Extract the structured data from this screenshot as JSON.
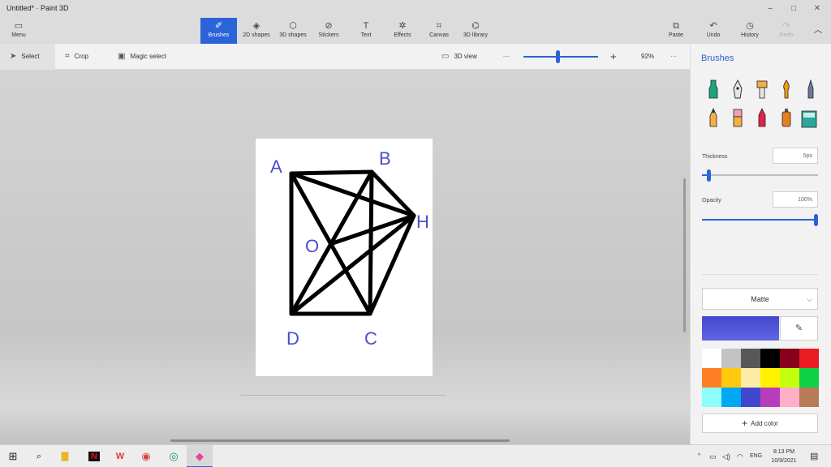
{
  "window": {
    "title": "Untitled* · Paint 3D",
    "controls": [
      "–",
      "□",
      "✕"
    ]
  },
  "ribbon": {
    "menu_label": "Menu",
    "tabs": [
      {
        "label": "Brushes",
        "icon": "brush-icon",
        "glyph": "✐"
      },
      {
        "label": "2D shapes",
        "icon": "2d-shapes-icon",
        "glyph": "◈"
      },
      {
        "label": "3D shapes",
        "icon": "3d-shapes-icon",
        "glyph": "⬡"
      },
      {
        "label": "Stickers",
        "icon": "stickers-icon",
        "glyph": "⊘"
      },
      {
        "label": "Text",
        "icon": "text-icon",
        "glyph": "T"
      },
      {
        "label": "Effects",
        "icon": "effects-icon",
        "glyph": "✲"
      },
      {
        "label": "Canvas",
        "icon": "canvas-icon",
        "glyph": "⌗"
      },
      {
        "label": "3D library",
        "icon": "3d-library-icon",
        "glyph": "⌬"
      }
    ],
    "paste_label": "Paste",
    "undo_label": "Undo",
    "history_label": "History",
    "redo_label": "Redo"
  },
  "toolbar": {
    "select_label": "Select",
    "crop_label": "Crop",
    "magic_select_label": "Magic select",
    "view3d_label": "3D view",
    "zoom_minus": "—",
    "zoom_plus": "+",
    "zoom_value": "92%",
    "more": "···"
  },
  "drawing": {
    "labels": [
      "A",
      "B",
      "H",
      "O",
      "D",
      "C"
    ],
    "ink_color": "#4a4fc9"
  },
  "panel": {
    "title": "Brushes",
    "brushes": [
      "marker-icon",
      "calligraphy-pen-icon",
      "oil-brush-icon",
      "watercolor-icon",
      "pixel-pen-icon",
      "pencil-icon",
      "eraser-icon",
      "crayon-icon",
      "spray-can-icon",
      "fill-bucket-icon"
    ],
    "thickness_label": "Thickness",
    "thickness_value": "5px",
    "opacity_label": "Opacity",
    "opacity_value": "100%",
    "finish": "Matte",
    "current_color": "#4247cf",
    "swatches": [
      "#ffffff",
      "#c3c3c3",
      "#585858",
      "#000000",
      "#88001b",
      "#ec1c24",
      "#ff7f27",
      "#ffc90e",
      "#fdeca6",
      "#fff200",
      "#c4ff0e",
      "#0ed145",
      "#8cfffb",
      "#00a8f3",
      "#3f48cc",
      "#b83dba",
      "#ffaec8",
      "#b97a56"
    ],
    "add_color_label": "Add color"
  },
  "taskbar": {
    "apps": [
      {
        "name": "start-icon",
        "glyph": "⊞"
      },
      {
        "name": "search-icon",
        "glyph": "⌕"
      },
      {
        "name": "file-explorer-icon",
        "glyph": "▇"
      },
      {
        "name": "netflix-icon",
        "glyph": "N"
      },
      {
        "name": "wps-office-icon",
        "glyph": "W"
      },
      {
        "name": "chrome-icon",
        "glyph": "◉"
      },
      {
        "name": "chrome-profile-icon",
        "glyph": "◎"
      },
      {
        "name": "paint3d-icon",
        "glyph": "◆"
      }
    ],
    "tray_up": "^",
    "lang": "ENG",
    "time": "8:13 PM",
    "date": "10/9/2021"
  }
}
